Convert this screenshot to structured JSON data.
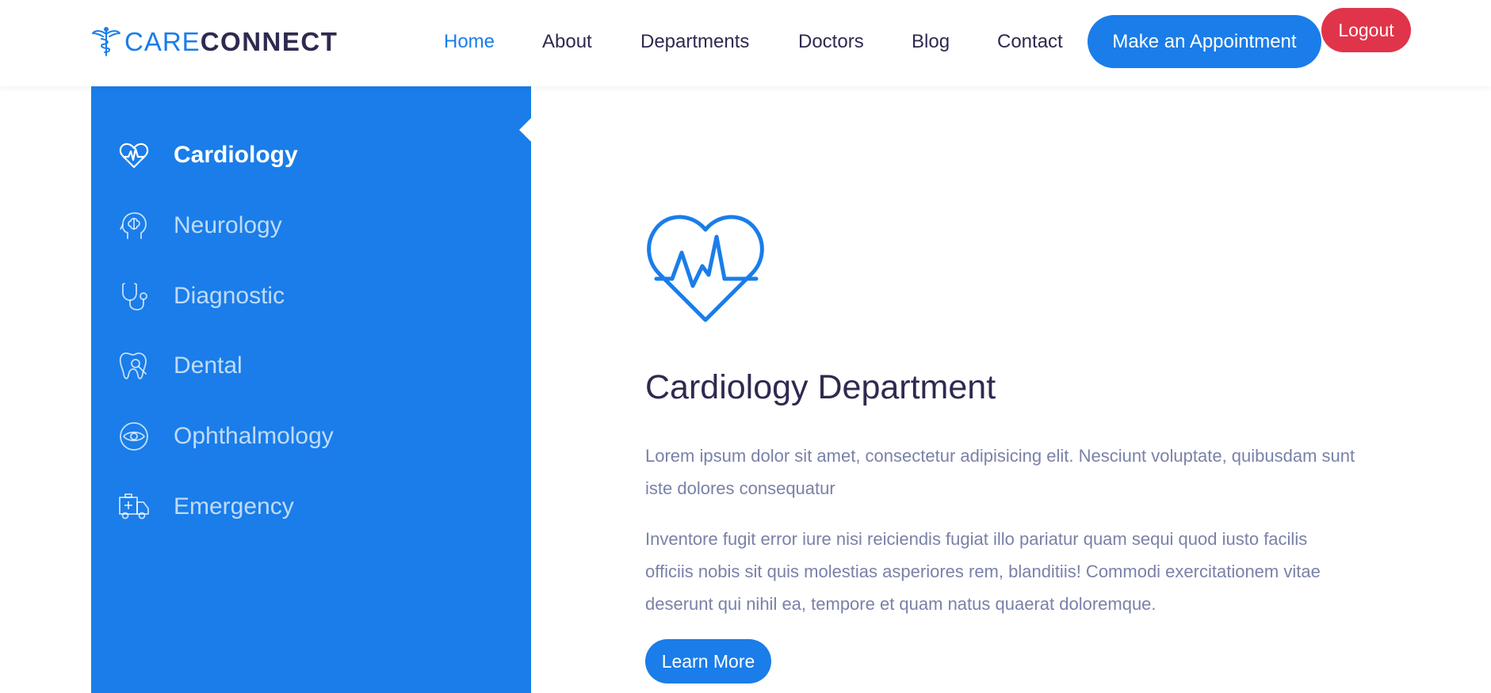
{
  "brand": {
    "name_part1": "CARE",
    "name_part2": "CONNECT",
    "icon": "caduceus-icon",
    "primary_color": "#1a7de9",
    "dark_color": "#2e2a50"
  },
  "nav": {
    "items": [
      {
        "label": "Home",
        "active": true
      },
      {
        "label": "About",
        "active": false
      },
      {
        "label": "Departments",
        "active": false
      },
      {
        "label": "Doctors",
        "active": false
      },
      {
        "label": "Blog",
        "active": false
      },
      {
        "label": "Contact",
        "active": false
      }
    ],
    "appointment_label": "Make an Appointment",
    "logout_label": "Logout",
    "logout_color": "#e0344a"
  },
  "sidebar": {
    "items": [
      {
        "label": "Cardiology",
        "icon": "heart-pulse-icon",
        "active": true
      },
      {
        "label": "Neurology",
        "icon": "brain-head-icon",
        "active": false
      },
      {
        "label": "Diagnostic",
        "icon": "stethoscope-icon",
        "active": false
      },
      {
        "label": "Dental",
        "icon": "tooth-icon",
        "active": false
      },
      {
        "label": "Ophthalmology",
        "icon": "eye-icon",
        "active": false
      },
      {
        "label": "Emergency",
        "icon": "ambulance-icon",
        "active": false
      }
    ]
  },
  "main": {
    "icon": "heart-pulse-icon",
    "title": "Cardiology Department",
    "paragraph1": "Lorem ipsum dolor sit amet, consectetur adipisicing elit. Nesciunt voluptate, quibusdam sunt iste dolores consequatur",
    "paragraph2": "Inventore fugit error iure nisi reiciendis fugiat illo pariatur quam sequi quod iusto facilis officiis nobis sit quis molestias asperiores rem, blanditiis! Commodi exercitationem vitae deserunt qui nihil ea, tempore et quam natus quaerat doloremque.",
    "button_label": "Learn More"
  }
}
